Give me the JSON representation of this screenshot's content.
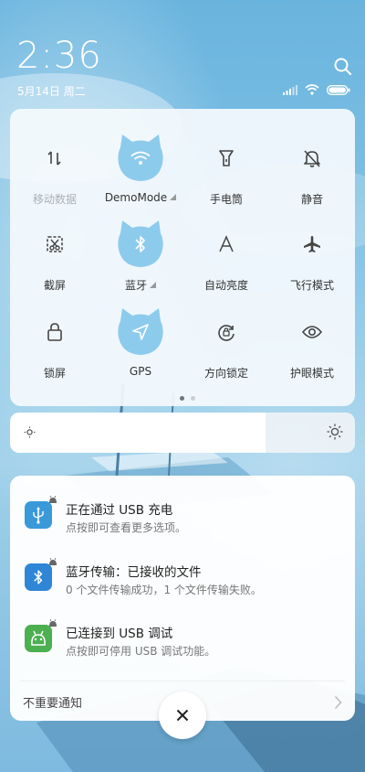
{
  "status": {
    "time": "2:36",
    "date": "5月14日 周二"
  },
  "quick_settings": {
    "tiles": [
      {
        "label": "移动数据",
        "icon": "mobile-data-icon",
        "active": false
      },
      {
        "label": "DemoMode",
        "icon": "wifi-icon",
        "active": true
      },
      {
        "label": "手电筒",
        "icon": "flashlight-icon",
        "active": false
      },
      {
        "label": "静音",
        "icon": "mute-bell-icon",
        "active": false
      },
      {
        "label": "截屏",
        "icon": "screenshot-icon",
        "active": false
      },
      {
        "label": "蓝牙",
        "icon": "bluetooth-icon",
        "active": true
      },
      {
        "label": "自动亮度",
        "icon": "auto-brightness-icon",
        "active": false
      },
      {
        "label": "飞行模式",
        "icon": "airplane-icon",
        "active": false
      },
      {
        "label": "锁屏",
        "icon": "lock-icon",
        "active": false
      },
      {
        "label": "GPS",
        "icon": "location-arrow-icon",
        "active": true
      },
      {
        "label": "方向锁定",
        "icon": "rotation-lock-icon",
        "active": false
      },
      {
        "label": "护眼模式",
        "icon": "eye-icon",
        "active": false
      }
    ],
    "pages": 2,
    "current_page": 1
  },
  "brightness": {
    "level": 0.74
  },
  "notifications": {
    "items": [
      {
        "title": "正在通过 USB 充电",
        "text": "点按即可查看更多选项。",
        "icon": "usb-icon",
        "color": "#3a9ad9"
      },
      {
        "title": "蓝牙传输：已接收的文件",
        "text": "0 个文件传输成功，1 个文件传输失败。",
        "icon": "bluetooth-icon",
        "color": "#2f86d6"
      },
      {
        "title": "已连接到 USB 调试",
        "text": "点按即可停用 USB 调试功能。",
        "icon": "android-icon",
        "color": "#4caf50"
      }
    ],
    "unimportant_label": "不重要通知"
  },
  "colors": {
    "accent": "#8dcbed",
    "wallpaper": "#7bbde4"
  }
}
